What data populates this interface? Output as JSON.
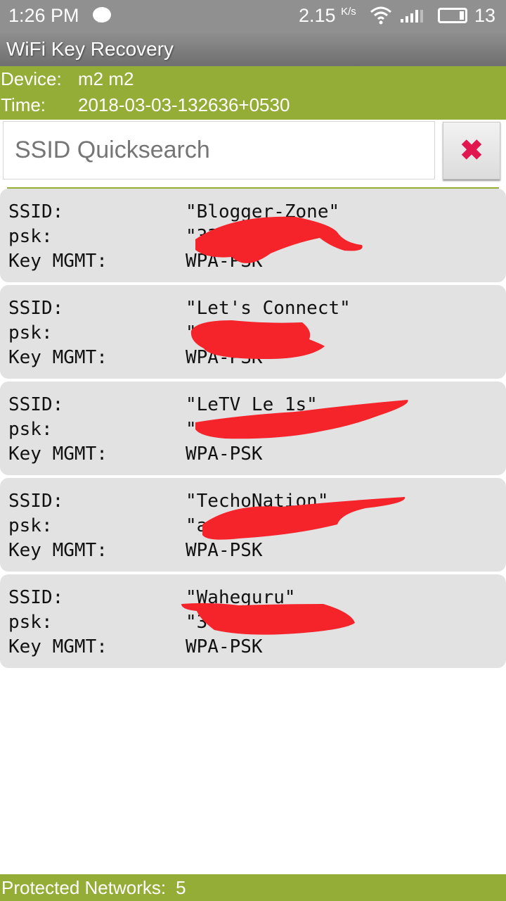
{
  "status_bar": {
    "time": "1:26 PM",
    "net_speed": "2.15",
    "net_unit": "K/s",
    "battery": "13",
    "icons": [
      "chat-icon",
      "wifi-icon",
      "signal-icon",
      "battery-icon"
    ]
  },
  "app": {
    "title": "WiFi Key Recovery"
  },
  "info": {
    "device_label": "Device:",
    "device_value": "m2 m2",
    "time_label": "Time:",
    "time_value": "2018-03-03-132636+0530"
  },
  "search": {
    "placeholder": "SSID Quicksearch",
    "value": "",
    "clear_icon": "close-x-icon",
    "clear_color": "#e0184f"
  },
  "labels": {
    "ssid": "SSID:",
    "psk": "psk:",
    "key_mgmt": "Key MGMT:"
  },
  "networks": [
    {
      "ssid": "\"Blogger-Zone\"",
      "psk": "\"33",
      "key_mgmt": "WPA-PSK"
    },
    {
      "ssid": "\"Let's Connect\"",
      "psk": "\"",
      "key_mgmt": "WPA-PSK"
    },
    {
      "ssid": "\"LeTV Le 1s\"",
      "psk": "\"",
      "key_mgmt": "WPA-PSK"
    },
    {
      "ssid": "\"TechoNation\"",
      "psk": "\"ac",
      "key_mgmt": "WPA-PSK"
    },
    {
      "ssid": "\"Waheguru\"",
      "psk": "\"3",
      "key_mgmt": "WPA-PSK"
    }
  ],
  "footer": {
    "label": "Protected Networks:",
    "count": "5"
  },
  "colors": {
    "accent_green": "#93ad37",
    "card_bg": "#e1e2e1",
    "redaction": "#f5232a"
  }
}
